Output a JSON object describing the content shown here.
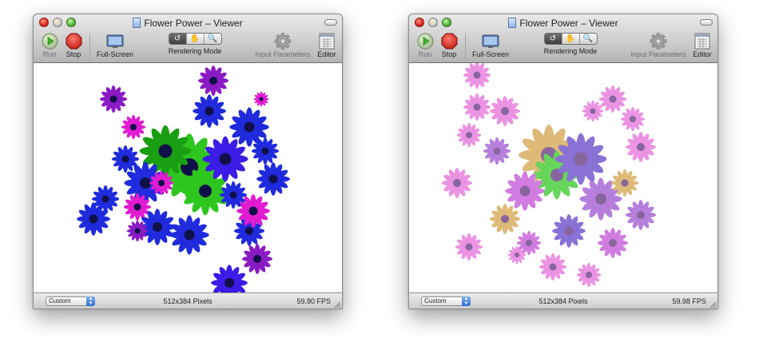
{
  "windows": [
    {
      "title": "Flower Power – Viewer",
      "toolbar": {
        "run": "Run",
        "stop": "Stop",
        "fullscreen": "Full-Screen",
        "rendering_mode": "Rendering Mode",
        "input_parameters": "Input Parameters",
        "editor": "Editor"
      },
      "segments": [
        "↺",
        "✋",
        "🔍"
      ],
      "status": {
        "preset": "Custom",
        "dimensions": "512x384 Pixels",
        "fps": "59.80 FPS"
      }
    },
    {
      "title": "Flower Power – Viewer",
      "toolbar": {
        "run": "Run",
        "stop": "Stop",
        "fullscreen": "Full-Screen",
        "rendering_mode": "Rendering Mode",
        "input_parameters": "Input Parameters",
        "editor": "Editor"
      },
      "segments": [
        "↺",
        "✋",
        "🔍"
      ],
      "status": {
        "preset": "Custom",
        "dimensions": "512x384 Pixels",
        "fps": "59.98 FPS"
      }
    }
  ],
  "icons": {
    "run": "play-icon",
    "stop": "stop-octagon-icon",
    "fullscreen": "monitor-icon",
    "input_parameters": "gear-icon",
    "editor": "grid-document-icon"
  },
  "colors": {
    "run_green": "#3fae2a",
    "stop_red": "#d8241b",
    "preset_blue": "#2d6ccd",
    "flower_left": [
      "#1f2bdc",
      "#3b1be6",
      "#e11bd1",
      "#8a1bc4",
      "#2ec61e"
    ],
    "flower_right": [
      "#e46ad9",
      "#c04ad6",
      "#9b4fcf",
      "#5d3bc6",
      "#d0a045",
      "#2ec61e"
    ]
  }
}
